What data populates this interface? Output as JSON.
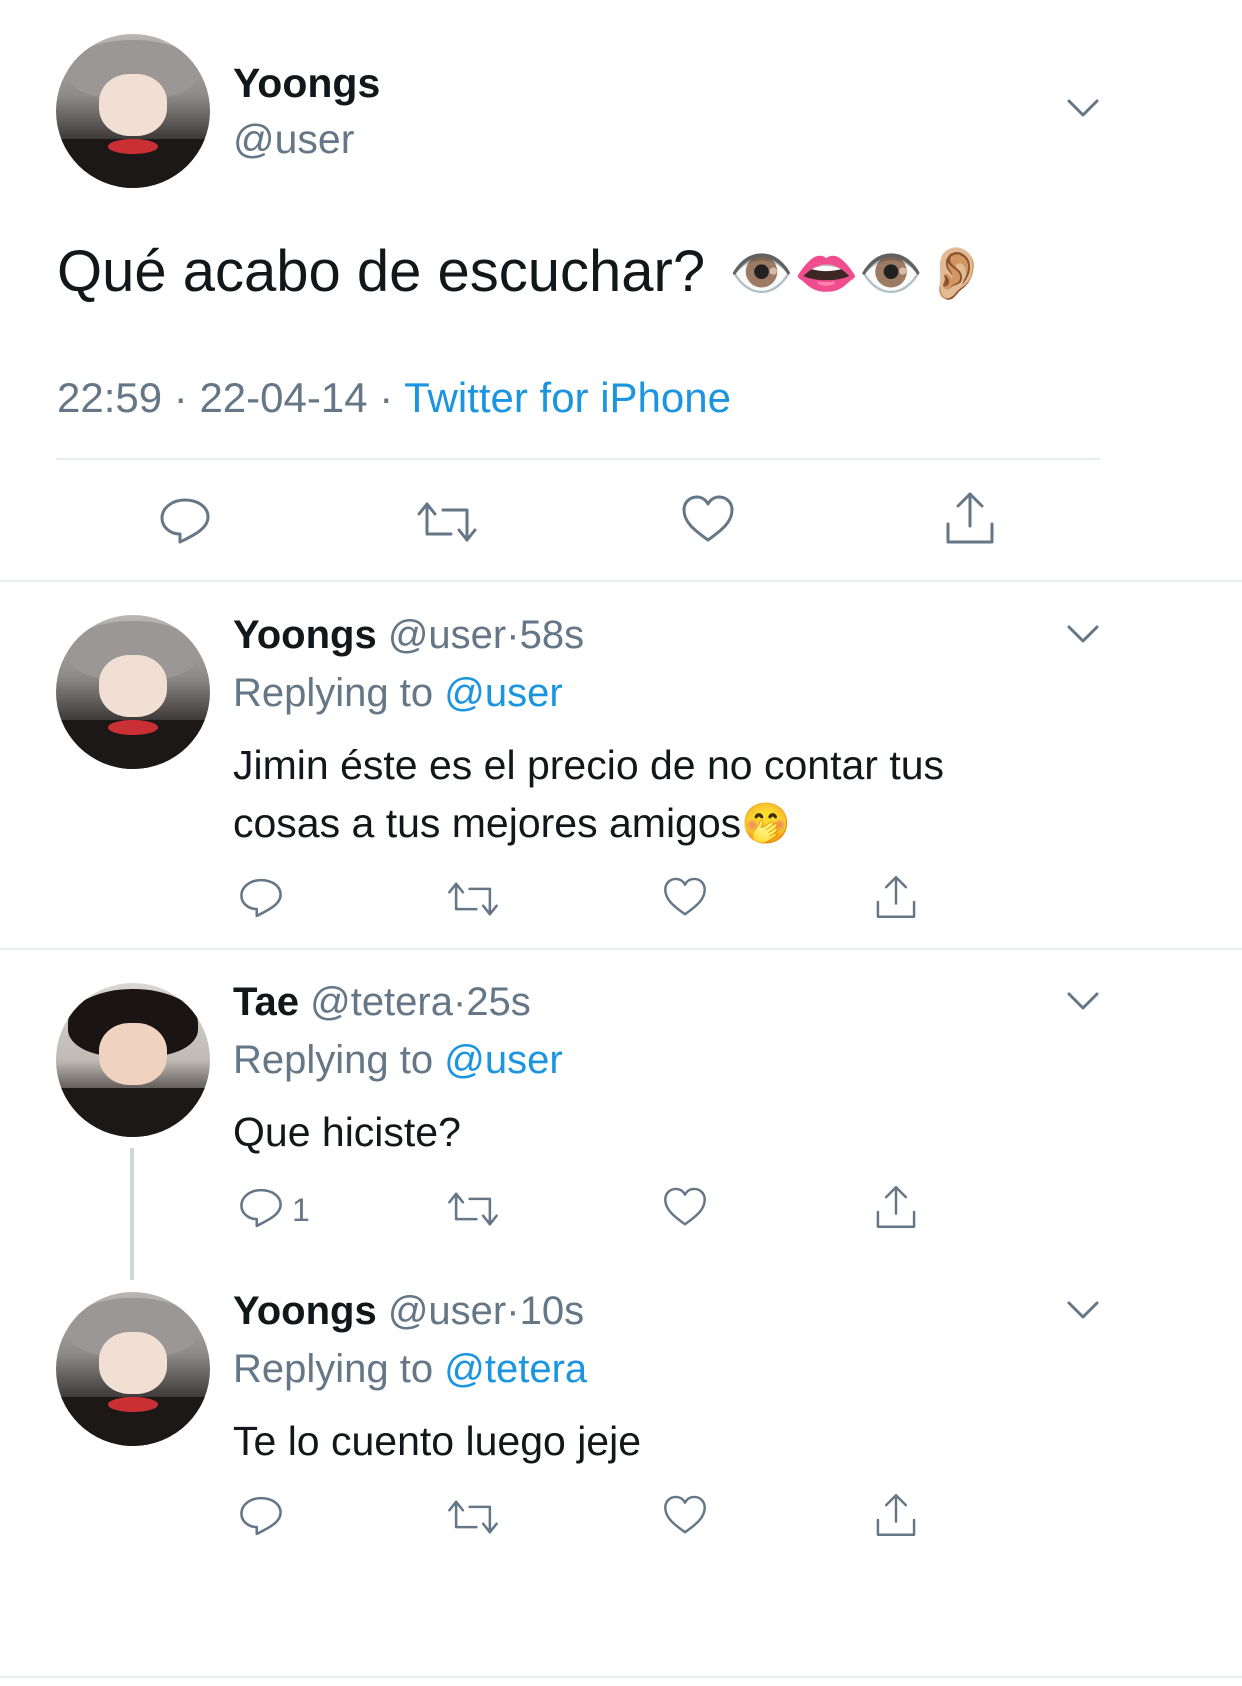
{
  "main_tweet": {
    "display_name": "Yoongs",
    "handle": "@user",
    "text": "Qué acabo de escuchar?",
    "emojis": "👁️👄👁️👂🏼",
    "time": "22:59",
    "date": "22-04-14",
    "source": "Twitter for iPhone"
  },
  "replies": [
    {
      "display_name": "Yoongs",
      "handle": "@user",
      "age": "58s",
      "replying_prefix": "Replying to",
      "replying_to": "@user",
      "text_line1": "Jimin éste es el precio de no contar tus",
      "text_line2": "cosas a tus mejores amigos",
      "emoji": "🤭"
    },
    {
      "display_name": "Tae",
      "handle": "@tetera",
      "age": "25s",
      "replying_prefix": "Replying to",
      "replying_to": "@user",
      "text": "Que hiciste?",
      "reply_count": "1"
    },
    {
      "display_name": "Yoongs",
      "handle": "@user",
      "age": "10s",
      "replying_prefix": "Replying to",
      "replying_to": "@tetera",
      "text": "Te lo cuento luego jeje"
    }
  ],
  "separator": "·",
  "colors": {
    "link": "#1b95e0",
    "muted": "#657786",
    "text": "#14171a",
    "divider": "#e6ecf0"
  },
  "icons": [
    "reply-icon",
    "retweet-icon",
    "like-icon",
    "share-icon",
    "chevron-down-icon"
  ]
}
